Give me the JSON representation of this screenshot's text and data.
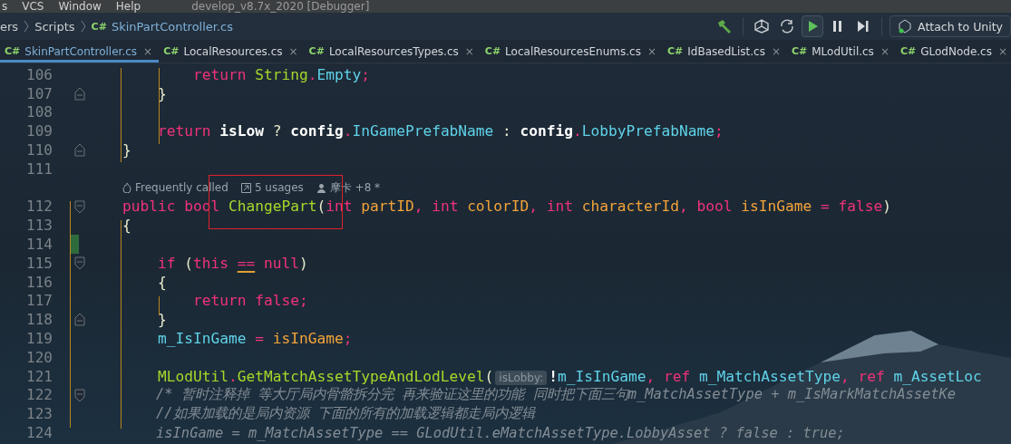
{
  "menu_bar": {
    "items": [
      "s",
      "VCS",
      "Window",
      "Help"
    ],
    "title": "develop_v8.7x_2020 [Debugger]"
  },
  "breadcrumb": {
    "items": [
      "ers",
      "Scripts"
    ],
    "file_lang": "C#",
    "file": "SkinPartController.cs"
  },
  "toolbar": {
    "attach_button": "Attach to Unity"
  },
  "tabs": [
    {
      "lang": "C#",
      "label": "SkinPartController.cs",
      "close": "×",
      "selected": true
    },
    {
      "lang": "C#",
      "label": "LocalResources.cs",
      "close": "×",
      "selected": false
    },
    {
      "lang": "C#",
      "label": "LocalResourcesTypes.cs",
      "close": "×",
      "selected": false
    },
    {
      "lang": "C#",
      "label": "LocalResourcesEnums.cs",
      "close": "×",
      "selected": false
    },
    {
      "lang": "C#",
      "label": "IdBasedList.cs",
      "close": "×",
      "selected": false
    },
    {
      "lang": "C#",
      "label": "MLodUtil.cs",
      "close": "×",
      "selected": false
    },
    {
      "lang": "C#",
      "label": "GLodNode.cs",
      "close": "×",
      "selected": false
    }
  ],
  "editor": {
    "lines": [
      {
        "number": "106",
        "kind": "plain",
        "changed": false,
        "tokens": [
          {
            "kind": "keyword",
            "text": "        return "
          },
          {
            "kind": "type",
            "text": "String"
          },
          {
            "kind": "op",
            "text": "."
          },
          {
            "kind": "field",
            "text": "Empty"
          },
          {
            "kind": "op",
            "text": ";"
          }
        ]
      },
      {
        "number": "107",
        "kind": "closer",
        "changed": false,
        "tokens": [
          {
            "kind": "plain",
            "text": "    }"
          }
        ]
      },
      {
        "number": "108",
        "kind": "plain",
        "changed": false
      },
      {
        "number": "109",
        "kind": "plain",
        "changed": false,
        "tokens": [
          {
            "kind": "keyword",
            "text": "    return "
          },
          {
            "kind": "local",
            "text": "isLow "
          },
          {
            "kind": "plain",
            "text": "? "
          },
          {
            "kind": "local",
            "text": "config"
          },
          {
            "kind": "op",
            "text": "."
          },
          {
            "kind": "field",
            "text": "InGamePrefabName "
          },
          {
            "kind": "plain",
            "text": ": "
          },
          {
            "kind": "local",
            "text": "config"
          },
          {
            "kind": "op",
            "text": "."
          },
          {
            "kind": "field",
            "text": "LobbyPrefabName"
          },
          {
            "kind": "op",
            "text": ";"
          }
        ]
      },
      {
        "number": "110",
        "kind": "closer",
        "changed": false,
        "tokens": [
          {
            "kind": "plain",
            "text": "}"
          }
        ]
      },
      {
        "number": "111",
        "kind": "plain",
        "changed": false
      },
      {
        "number": "112",
        "kind": "opener",
        "changed": false,
        "hints": {
          "frequency": "Frequently called",
          "usages": "5 usages",
          "author": "摩卡 +8 *"
        },
        "tokens": [
          {
            "kind": "keyword",
            "text": "public bool "
          },
          {
            "kind": "method",
            "text": "ChangePart"
          },
          {
            "kind": "plain",
            "text": "("
          },
          {
            "kind": "keyword",
            "text": "int "
          },
          {
            "kind": "param",
            "text": "partID"
          },
          {
            "kind": "op",
            "text": ", "
          },
          {
            "kind": "keyword",
            "text": "int "
          },
          {
            "kind": "param",
            "text": "colorID"
          },
          {
            "kind": "op",
            "text": ", "
          },
          {
            "kind": "keyword",
            "text": "int "
          },
          {
            "kind": "param",
            "text": "characterId"
          },
          {
            "kind": "op",
            "text": ", "
          },
          {
            "kind": "keyword",
            "text": "bool "
          },
          {
            "kind": "param",
            "text": "isInGame "
          },
          {
            "kind": "op",
            "text": "= "
          },
          {
            "kind": "keyword",
            "text": "false"
          },
          {
            "kind": "plain",
            "text": ")"
          }
        ]
      },
      {
        "number": "113",
        "kind": "plain",
        "changed": false,
        "tokens": [
          {
            "kind": "plain",
            "text": "{"
          }
        ]
      },
      {
        "number": "114",
        "kind": "plain",
        "changed": true
      },
      {
        "number": "115",
        "kind": "opener",
        "changed": false,
        "tokens": [
          {
            "kind": "keyword",
            "text": "    if "
          },
          {
            "kind": "plain",
            "text": "("
          },
          {
            "kind": "keyword",
            "text": "this "
          },
          {
            "kind": "warning",
            "text": "=="
          },
          {
            "kind": "keyword",
            "text": " null"
          },
          {
            "kind": "plain",
            "text": ")"
          }
        ]
      },
      {
        "number": "116",
        "kind": "plain",
        "changed": false,
        "tokens": [
          {
            "kind": "plain",
            "text": "    {"
          }
        ]
      },
      {
        "number": "117",
        "kind": "plain",
        "changed": false,
        "tokens": [
          {
            "kind": "keyword",
            "text": "        return false"
          },
          {
            "kind": "op",
            "text": ";"
          }
        ]
      },
      {
        "number": "118",
        "kind": "closer",
        "changed": false,
        "tokens": [
          {
            "kind": "plain",
            "text": "    }"
          }
        ]
      },
      {
        "number": "119",
        "kind": "plain",
        "changed": false,
        "tokens": [
          {
            "kind": "field",
            "text": "    m_IsInGame "
          },
          {
            "kind": "op",
            "text": "= "
          },
          {
            "kind": "param",
            "text": "isInGame"
          },
          {
            "kind": "op",
            "text": ";"
          }
        ]
      },
      {
        "number": "120",
        "kind": "plain",
        "changed": false
      },
      {
        "number": "121",
        "kind": "plain",
        "changed": false,
        "tokens": [
          {
            "kind": "method",
            "text": "    MLodUtil"
          },
          {
            "kind": "op",
            "text": "."
          },
          {
            "kind": "method",
            "text": "GetMatchAssetTypeAndLodLevel"
          },
          {
            "kind": "plain",
            "text": "("
          },
          {
            "kind": "hint",
            "text": "isLobby:"
          },
          {
            "kind": "local",
            "text": "!"
          },
          {
            "kind": "field",
            "text": "m_IsInGame"
          },
          {
            "kind": "op",
            "text": ", "
          },
          {
            "kind": "keyword",
            "text": "ref "
          },
          {
            "kind": "field",
            "text": "m_MatchAssetType"
          },
          {
            "kind": "op",
            "text": ", "
          },
          {
            "kind": "keyword",
            "text": "ref "
          },
          {
            "kind": "field",
            "text": "m_AssetLoc"
          }
        ]
      },
      {
        "number": "122",
        "kind": "opener",
        "changed": false,
        "tokens": [
          {
            "kind": "comment",
            "text": "    /* 暂时注释掉 等大厅局内骨骼拆分完 再来验证这里的功能 同时把下面三句m_MatchAssetType + m_IsMarkMatchAssetKe"
          }
        ]
      },
      {
        "number": "123",
        "kind": "plain",
        "changed": false,
        "tokens": [
          {
            "kind": "comment",
            "text": "    //如果加载的是局内资源 下面的所有的加载逻辑都走局内逻辑"
          }
        ]
      },
      {
        "number": "124",
        "kind": "plain",
        "changed": false,
        "tokens": [
          {
            "kind": "comment",
            "text": "    isInGame = m_MatchAssetType == GLodUtil.eMatchAssetType.LobbyAsset ? false : true;"
          }
        ]
      }
    ]
  }
}
